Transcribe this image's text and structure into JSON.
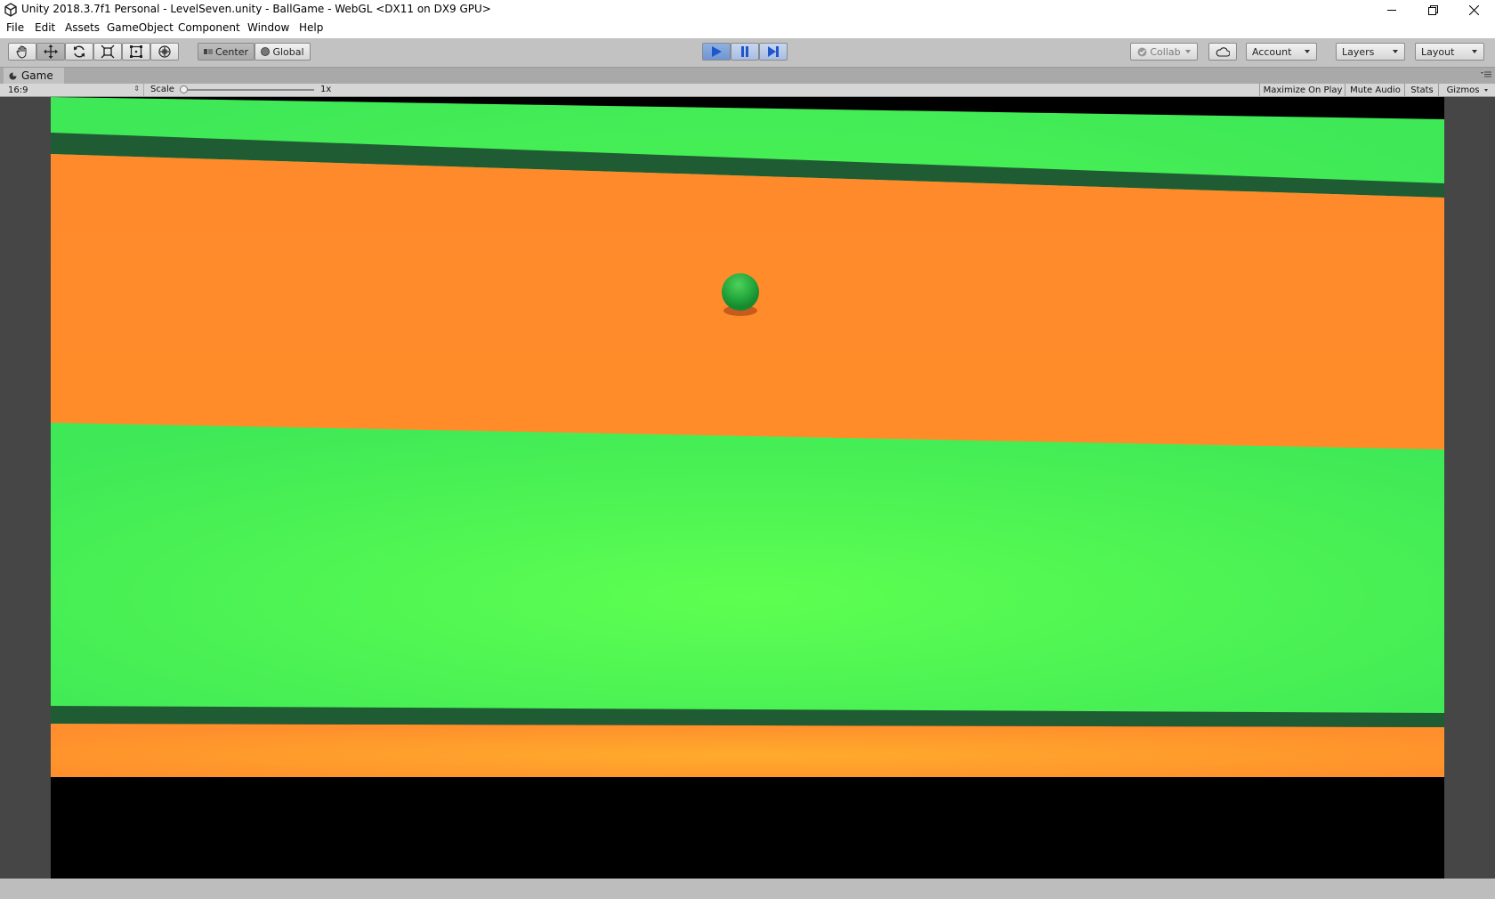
{
  "window": {
    "title": "Unity 2018.3.7f1 Personal - LevelSeven.unity - BallGame - WebGL <DX11 on DX9 GPU>",
    "icon": "unity-logo-icon",
    "controls": [
      "minimize-icon",
      "restore-icon",
      "close-icon"
    ]
  },
  "menu": {
    "items": [
      "File",
      "Edit",
      "Assets",
      "GameObject",
      "Component",
      "Window",
      "Help"
    ]
  },
  "toolbar": {
    "tools": [
      "hand-tool-icon",
      "move-tool-icon",
      "rotate-tool-icon",
      "scale-tool-icon",
      "rect-tool-icon",
      "transform-tool-icon"
    ],
    "active_tool": "move-tool-icon",
    "pivot_label": "Center",
    "space_label": "Global",
    "play_controls": [
      "play-icon",
      "pause-icon",
      "step-icon"
    ],
    "play_active": true,
    "collab_label": "Collab",
    "account_label": "Account",
    "layers_label": "Layers",
    "layout_label": "Layout"
  },
  "game_panel": {
    "tab_label": "Game",
    "aspect_label": "16:9",
    "scale_label": "Scale",
    "scale_value": "1x",
    "buttons": [
      "Maximize On Play",
      "Mute Audio",
      "Stats",
      "Gizmos"
    ]
  },
  "colors": {
    "orange": "#ff8c2e",
    "green": "#4cf455",
    "dark_green": "#1f5b33",
    "ball": "#2bb33f",
    "letterbox": "#000000",
    "panel_bg": "#464646",
    "play_blue": "#6f95d3"
  }
}
